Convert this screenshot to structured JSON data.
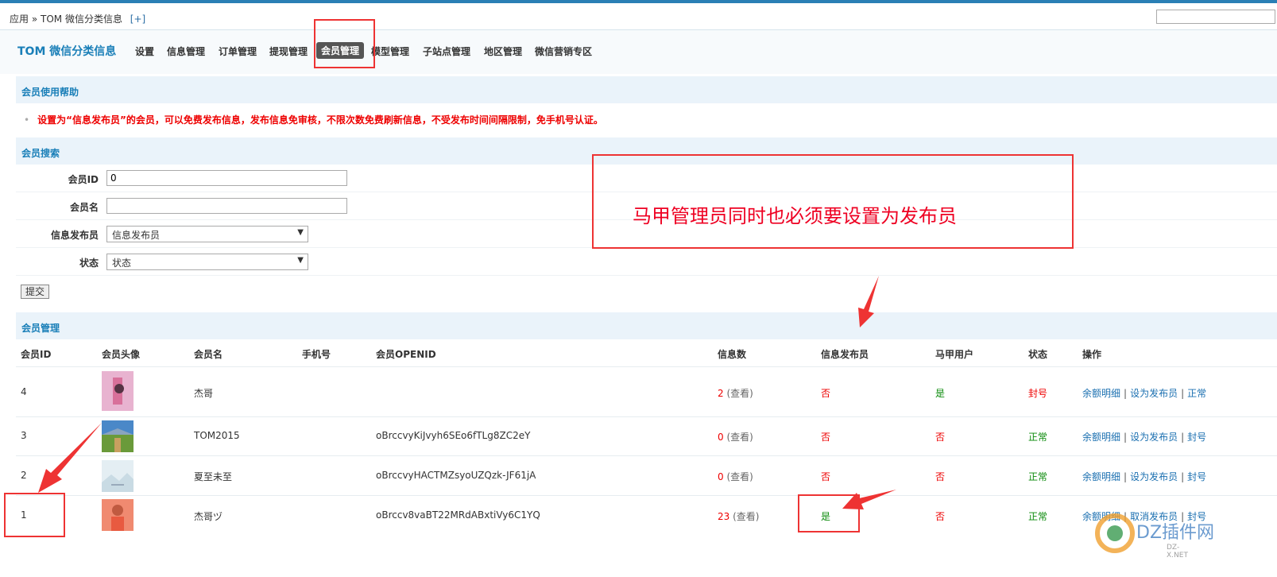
{
  "breadcrumb": {
    "app": "应用",
    "sep": "»",
    "current": "TOM 微信分类信息",
    "plus": "[+]"
  },
  "nav": {
    "title": "TOM 微信分类信息",
    "items": [
      "设置",
      "信息管理",
      "订单管理",
      "提现管理",
      "会员管理",
      "模型管理",
      "子站点管理",
      "地区管理",
      "微信营销专区"
    ],
    "active_index": 4
  },
  "help_section": {
    "title": "会员使用帮助",
    "text": "设置为“信息发布员”的会员，可以免费发布信息，发布信息免审核，不限次数免费刷新信息，不受发布时间间隔限制，免手机号认证。"
  },
  "search_section": {
    "title": "会员搜索",
    "member_id_label": "会员ID",
    "member_id_value": "0",
    "member_name_label": "会员名",
    "member_name_value": "",
    "publisher_label": "信息发布员",
    "publisher_selected": "信息发布员",
    "status_label": "状态",
    "status_selected": "状态",
    "submit_label": "提交"
  },
  "members_section": {
    "title": "会员管理",
    "columns": [
      "会员ID",
      "会员头像",
      "会员名",
      "手机号",
      "会员OPENID",
      "信息数",
      "信息发布员",
      "马甲用户",
      "状态",
      "操作"
    ],
    "rows": [
      {
        "id": "4",
        "name": "杰哥",
        "phone": "",
        "openid": "",
        "info_count": "2",
        "view": "(查看)",
        "publisher": "否",
        "vest": "是",
        "status": "封号",
        "op1": "余额明细",
        "op2": "设为发布员",
        "op3": "正常"
      },
      {
        "id": "3",
        "name": "TOM2015",
        "phone": "",
        "openid": "oBrccvyKiJvyh6SEo6fTLg8ZC2eY",
        "info_count": "0",
        "view": "(查看)",
        "publisher": "否",
        "vest": "否",
        "status": "正常",
        "op1": "余额明细",
        "op2": "设为发布员",
        "op3": "封号"
      },
      {
        "id": "2",
        "name": "夏至未至",
        "phone": "",
        "openid": "oBrccvyHACTMZsyoUZQzk-JF61jA",
        "info_count": "0",
        "view": "(查看)",
        "publisher": "否",
        "vest": "否",
        "status": "正常",
        "op1": "余额明细",
        "op2": "设为发布员",
        "op3": "封号"
      },
      {
        "id": "1",
        "name": "杰哥ヅ",
        "phone": "",
        "openid": "oBrccv8vaBT22MRdABxtiVy6C1YQ",
        "info_count": "23",
        "view": "(查看)",
        "publisher": "是",
        "vest": "否",
        "status": "正常",
        "op1": "余额明细",
        "op2": "取消发布员",
        "op3": "封号"
      }
    ],
    "op_sep": "|"
  },
  "annotation": {
    "text": "马甲管理员同时也必须要设置为发布员"
  },
  "watermark": {
    "text": "DZ插件网",
    "sub": "DZ-X.NET"
  },
  "colors": {
    "accent": "#1a7fb8",
    "warning": "#e00000",
    "ok": "#0a8a0a",
    "annotation": "#e33333"
  }
}
